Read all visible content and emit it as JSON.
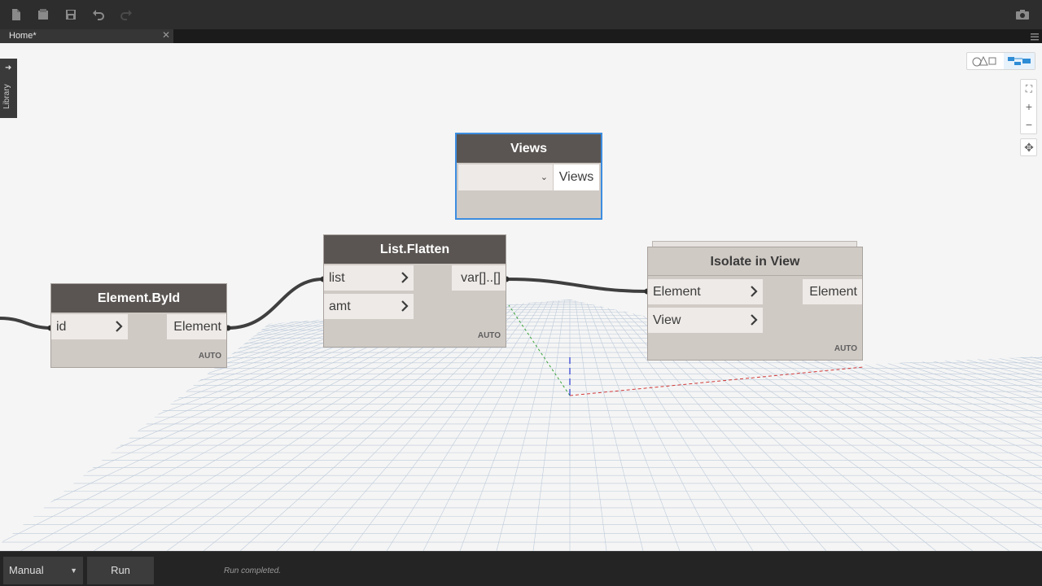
{
  "tabs": [
    {
      "label": "Home*"
    }
  ],
  "library": {
    "label": "Library"
  },
  "nodes": {
    "element_byid": {
      "title": "Element.ById",
      "inputs": [
        "id"
      ],
      "outputs": [
        "Element"
      ],
      "lacing": "AUTO"
    },
    "list_flatten": {
      "title": "List.Flatten",
      "inputs": [
        "list",
        "amt"
      ],
      "outputs": [
        "var[]..[]"
      ],
      "lacing": "AUTO"
    },
    "views": {
      "title": "Views",
      "selected": "",
      "outputs": [
        "Views"
      ]
    },
    "isolate_in_view": {
      "title": "Isolate in View",
      "inputs": [
        "Element",
        "View"
      ],
      "outputs": [
        "Element"
      ],
      "lacing": "AUTO"
    }
  },
  "runbar": {
    "mode": "Manual",
    "run_label": "Run",
    "status": "Run completed."
  },
  "icons": {
    "toolbar": [
      "new-file-icon",
      "open-folder-icon",
      "save-icon",
      "undo-icon",
      "redo-icon",
      "camera-icon"
    ],
    "view_controls": [
      "background-preview-icon",
      "graph-view-icon",
      "zoom-to-fit-icon",
      "zoom-in-icon",
      "zoom-out-icon",
      "pan-icon"
    ]
  },
  "colors": {
    "node_header": "#5a5552",
    "node_body": "#d0cac5",
    "selected_border": "#3c8de0",
    "wire": "#3f3f3f",
    "accent": "#2f8dd6"
  }
}
